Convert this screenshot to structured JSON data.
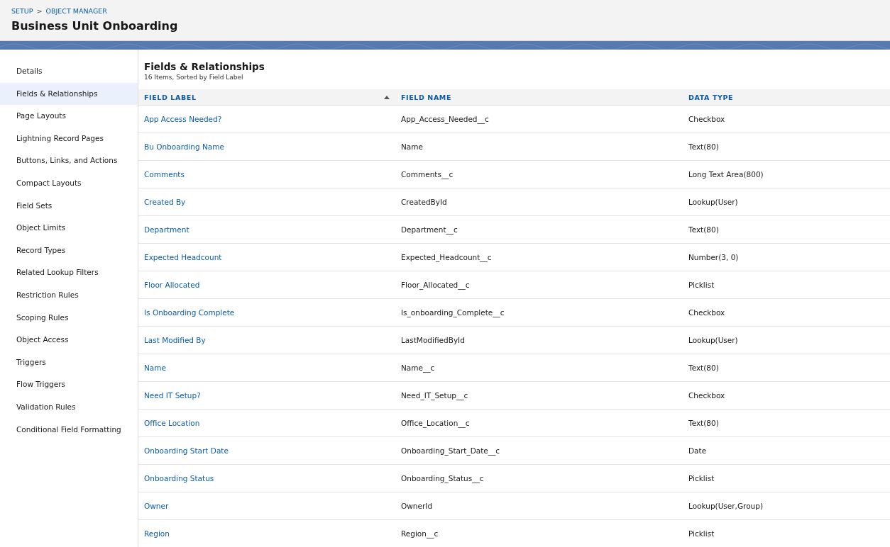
{
  "breadcrumb": {
    "items": [
      "SETUP",
      "OBJECT MANAGER"
    ],
    "separator": ">"
  },
  "title": "Business Unit Onboarding",
  "sidebar": {
    "items": [
      {
        "label": "Details",
        "selected": false
      },
      {
        "label": "Fields & Relationships",
        "selected": true
      },
      {
        "label": "Page Layouts",
        "selected": false
      },
      {
        "label": "Lightning Record Pages",
        "selected": false
      },
      {
        "label": "Buttons, Links, and Actions",
        "selected": false
      },
      {
        "label": "Compact Layouts",
        "selected": false
      },
      {
        "label": "Field Sets",
        "selected": false
      },
      {
        "label": "Object Limits",
        "selected": false
      },
      {
        "label": "Record Types",
        "selected": false
      },
      {
        "label": "Related Lookup Filters",
        "selected": false
      },
      {
        "label": "Restriction Rules",
        "selected": false
      },
      {
        "label": "Scoping Rules",
        "selected": false
      },
      {
        "label": "Object Access",
        "selected": false
      },
      {
        "label": "Triggers",
        "selected": false
      },
      {
        "label": "Flow Triggers",
        "selected": false
      },
      {
        "label": "Validation Rules",
        "selected": false
      },
      {
        "label": "Conditional Field Formatting",
        "selected": false
      }
    ]
  },
  "section": {
    "title": "Fields & Relationships",
    "subtitle": "16 Items, Sorted by Field Label"
  },
  "table": {
    "columns": [
      {
        "label": "FIELD LABEL",
        "sorted": true
      },
      {
        "label": "FIELD NAME",
        "sorted": false
      },
      {
        "label": "DATA TYPE",
        "sorted": false
      }
    ],
    "rows": [
      [
        "App Access Needed?",
        "App_Access_Needed__c",
        "Checkbox"
      ],
      [
        "Bu Onboarding Name",
        "Name",
        "Text(80)"
      ],
      [
        "Comments",
        "Comments__c",
        "Long Text Area(800)"
      ],
      [
        "Created By",
        "CreatedById",
        "Lookup(User)"
      ],
      [
        "Department",
        "Department__c",
        "Text(80)"
      ],
      [
        "Expected Headcount",
        "Expected_Headcount__c",
        "Number(3, 0)"
      ],
      [
        "Floor Allocated",
        "Floor_Allocated__c",
        "Picklist"
      ],
      [
        "Is Onboarding Complete",
        "Is_onboarding_Complete__c",
        "Checkbox"
      ],
      [
        "Last Modified By",
        "LastModifiedById",
        "Lookup(User)"
      ],
      [
        "Name",
        "Name__c",
        "Text(80)"
      ],
      [
        "Need IT Setup?",
        "Need_IT_Setup__c",
        "Checkbox"
      ],
      [
        "Office Location",
        "Office_Location__c",
        "Text(80)"
      ],
      [
        "Onboarding Start Date",
        "Onboarding_Start_Date__c",
        "Date"
      ],
      [
        "Onboarding Status",
        "Onboarding_Status__c",
        "Picklist"
      ],
      [
        "Owner",
        "OwnerId",
        "Lookup(User,Group)"
      ],
      [
        "Region",
        "Region__c",
        "Picklist"
      ]
    ]
  }
}
